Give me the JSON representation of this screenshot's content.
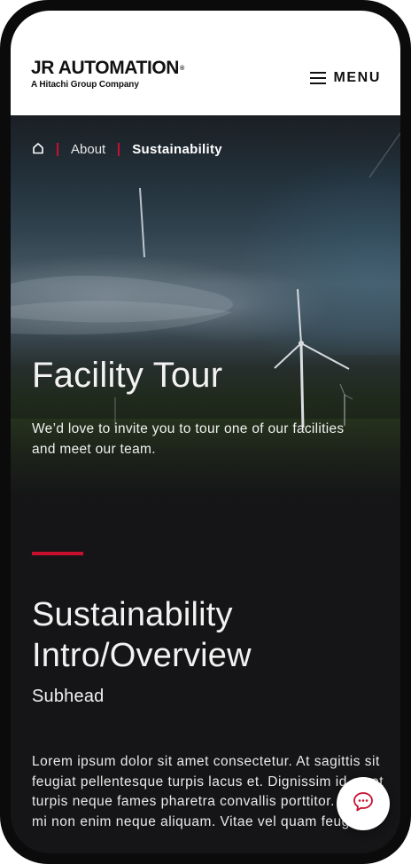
{
  "header": {
    "logo_main": "JR AUTOMATION",
    "logo_mark": "®",
    "logo_sub": "A Hitachi Group Company",
    "menu_label": "MENU"
  },
  "breadcrumb": {
    "items": [
      {
        "label": "About"
      },
      {
        "label": "Sustainability"
      }
    ]
  },
  "hero": {
    "title": "Facility Tour",
    "description": "We’d love to invite you to tour one of our facilities and meet our team."
  },
  "section": {
    "title_line1": "Sustainability",
    "title_line2": "Intro/Overview",
    "subhead": "Subhead",
    "body": "Lorem ipsum dolor sit amet consectetur. At sagittis sit feugiat pellentesque turpis lacus et. Dignissim id amet turpis neque fames pharetra convallis porttitor. Turpis mi non enim neque aliquam. Vitae vel quam feugiat"
  },
  "colors": {
    "accent": "#c8102e",
    "background": "#151517",
    "header_bg": "#ffffff"
  },
  "icons": {
    "home": "home-icon",
    "menu": "hamburger-icon",
    "chat": "chat-bubble-icon"
  }
}
